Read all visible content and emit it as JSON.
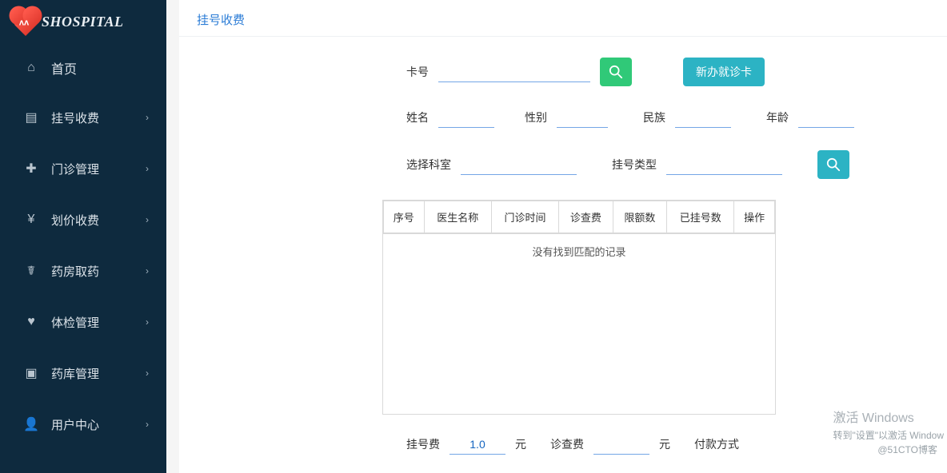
{
  "brand": "SHOSPITAL",
  "sidebar": {
    "items": [
      {
        "label": "首页",
        "icon": "home"
      },
      {
        "label": "挂号收费",
        "icon": "register",
        "expandable": true
      },
      {
        "label": "门诊管理",
        "icon": "outpatient",
        "expandable": true
      },
      {
        "label": "划价收费",
        "icon": "pricing",
        "expandable": true
      },
      {
        "label": "药房取药",
        "icon": "pharmacy",
        "expandable": true
      },
      {
        "label": "体检管理",
        "icon": "checkup",
        "expandable": true
      },
      {
        "label": "药库管理",
        "icon": "stock",
        "expandable": true
      },
      {
        "label": "用户中心",
        "icon": "user",
        "expandable": true
      }
    ]
  },
  "page": {
    "title": "挂号收费",
    "form": {
      "cardNo": {
        "label": "卡号",
        "value": ""
      },
      "btnNewCard": "新办就诊卡",
      "name": {
        "label": "姓名",
        "value": ""
      },
      "gender": {
        "label": "性别",
        "value": ""
      },
      "ethnicity": {
        "label": "民族",
        "value": ""
      },
      "age": {
        "label": "年龄",
        "value": ""
      },
      "department": {
        "label": "选择科室",
        "value": ""
      },
      "regType": {
        "label": "挂号类型",
        "value": ""
      },
      "regFee": {
        "label": "挂号费",
        "value": "1.0",
        "unit": "元"
      },
      "examFee": {
        "label": "诊查费",
        "value": "",
        "unit": "元"
      },
      "payMethod": {
        "label": "付款方式",
        "value": ""
      }
    },
    "table": {
      "columns": [
        "序号",
        "医生名称",
        "门诊时间",
        "诊查费",
        "限额数",
        "已挂号数",
        "操作"
      ],
      "empty": "没有找到匹配的记录",
      "rows": []
    }
  },
  "watermark": {
    "line1": "激活 Windows",
    "line2": "转到\"设置\"以激活 Window",
    "line3": "@51CTO博客"
  }
}
